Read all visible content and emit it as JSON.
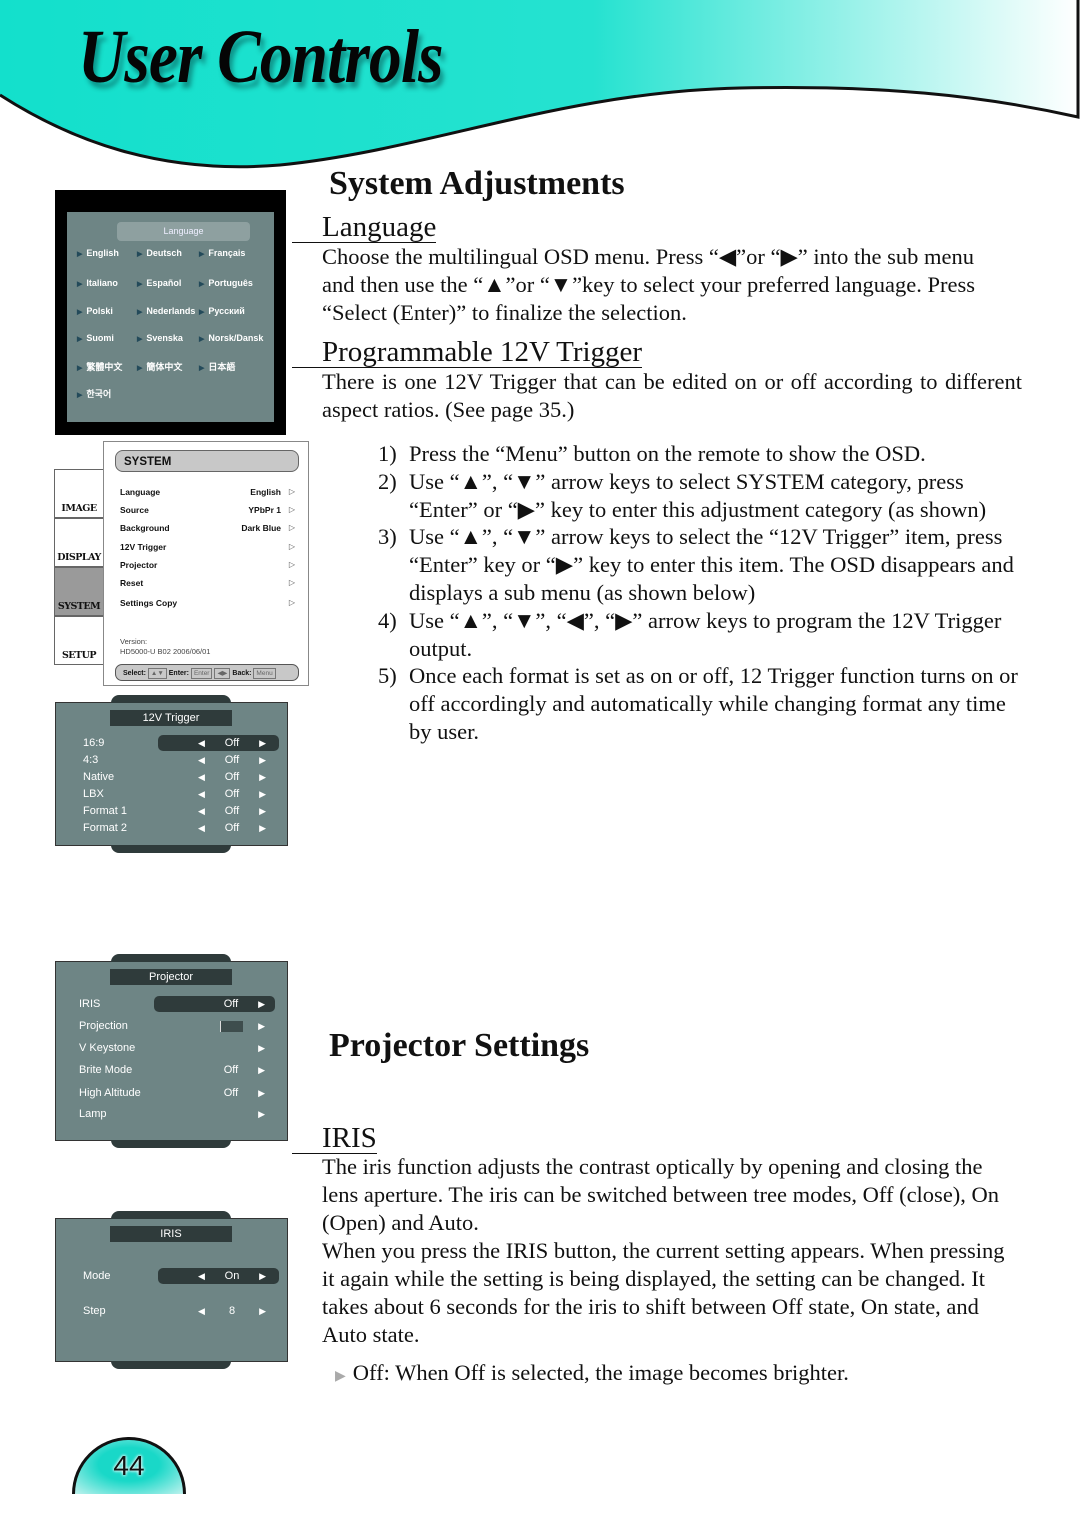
{
  "header": {
    "title": "User Controls",
    "banner_color": "#13e0cc"
  },
  "system_adjustments": {
    "heading": "System Adjustments",
    "language": {
      "subheading": "Language",
      "text": "Choose the multilingual OSD menu. Press “◀”or “▶” into the sub menu and then use the “▲”or “▼”key to select your preferred language. Press “Select (Enter)” to finalize the selection."
    },
    "trigger": {
      "subheading": "Programmable 12V Trigger",
      "text": "There is one 12V Trigger that can be edited on or off according to different aspect ratios. (See page 35.)",
      "steps": [
        {
          "num": "1)",
          "text": "Press the “Menu” button on the remote to show the OSD."
        },
        {
          "num": "2)",
          "text": "Use “▲”, “▼” arrow keys to select SYSTEM category, press “Enter” or “▶” key to enter this adjustment category (as shown)"
        },
        {
          "num": "3)",
          "text": "Use “▲”, “▼” arrow keys to select the “12V Trigger” item, press “Enter” key or “▶” key to enter this item. The OSD disappears and displays a sub menu (as shown below)"
        },
        {
          "num": "4)",
          "text": "Use “▲”, “▼”, “◀”, “▶” arrow keys to program the 12V Trigger output."
        },
        {
          "num": "5)",
          "text": "Once each format is set as on or off, 12 Trigger function turns on or off accordingly and automatically while changing format any time by user."
        }
      ]
    }
  },
  "projector_settings": {
    "heading": "Projector Settings",
    "iris": {
      "subheading": "IRIS",
      "text1": "The iris function adjusts the contrast optically by opening and closing the lens aperture. The iris can be switched between tree modes, Off (close), On (Open) and Auto.",
      "text2": "When you press the IRIS button, the current setting appears. When pressing it again while the setting is being displayed, the setting can be changed. It takes about 6 seconds for the iris to shift between Off state, On state, and Auto state.",
      "bullet": "Off: When Off is selected, the image becomes brighter."
    }
  },
  "osd_language": {
    "title": "Language",
    "items": [
      "English",
      "Deutsch",
      "Français",
      "Italiano",
      "Español",
      "Português",
      "Polski",
      "Nederlands",
      "Русский",
      "Suomi",
      "Svenska",
      "Norsk/Dansk",
      "繁體中文",
      "簡体中文",
      "日本語",
      "한국어"
    ]
  },
  "osd_system": {
    "tabs": [
      "IMAGE",
      "DISPLAY",
      "SYSTEM",
      "SETUP"
    ],
    "active_tab": "SYSTEM",
    "title": "SYSTEM",
    "rows": [
      {
        "label": "Language",
        "value": "English"
      },
      {
        "label": "Source",
        "value": "YPbPr 1"
      },
      {
        "label": "Background",
        "value": "Dark Blue"
      },
      {
        "label": "12V Trigger",
        "value": ""
      },
      {
        "label": "Projector",
        "value": ""
      },
      {
        "label": "Reset",
        "value": ""
      },
      {
        "label": "Settings Copy",
        "value": ""
      }
    ],
    "version_label": "Version:",
    "version": "HD5000-U B02 2006/06/01",
    "footer": {
      "select": "Select:",
      "enter": "Enter:",
      "enter_key": "Enter",
      "back": "Back:",
      "back_key": "Menu"
    }
  },
  "osd_trigger": {
    "title": "12V Trigger",
    "rows": [
      {
        "label": "16:9",
        "value": "Off"
      },
      {
        "label": "4:3",
        "value": "Off"
      },
      {
        "label": "Native",
        "value": "Off"
      },
      {
        "label": "LBX",
        "value": "Off"
      },
      {
        "label": "Format 1",
        "value": "Off"
      },
      {
        "label": "Format 2",
        "value": "Off"
      }
    ]
  },
  "osd_projector": {
    "title": "Projector",
    "rows": [
      {
        "label": "IRIS",
        "value": "Off"
      },
      {
        "label": "Projection",
        "value": ""
      },
      {
        "label": "V Keystone",
        "value": ""
      },
      {
        "label": "Brite Mode",
        "value": "Off"
      },
      {
        "label": "High Altitude",
        "value": "Off"
      },
      {
        "label": "Lamp",
        "value": ""
      }
    ]
  },
  "osd_iris": {
    "title": "IRIS",
    "rows": [
      {
        "label": "Mode",
        "value": "On"
      },
      {
        "label": "Step",
        "value": "8"
      }
    ]
  },
  "page_number": "44"
}
